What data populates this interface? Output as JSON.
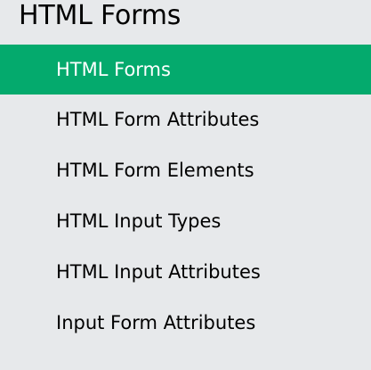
{
  "sidebar": {
    "title": "HTML Forms",
    "items": [
      {
        "label": "HTML Forms",
        "active": true
      },
      {
        "label": "HTML Form Attributes",
        "active": false
      },
      {
        "label": "HTML Form Elements",
        "active": false
      },
      {
        "label": "HTML Input Types",
        "active": false
      },
      {
        "label": "HTML Input Attributes",
        "active": false
      },
      {
        "label": "Input Form Attributes",
        "active": false
      }
    ]
  },
  "colors": {
    "background": "#e7e9eb",
    "active_background": "#04aa6d",
    "active_text": "#ffffff",
    "text": "#000000"
  }
}
